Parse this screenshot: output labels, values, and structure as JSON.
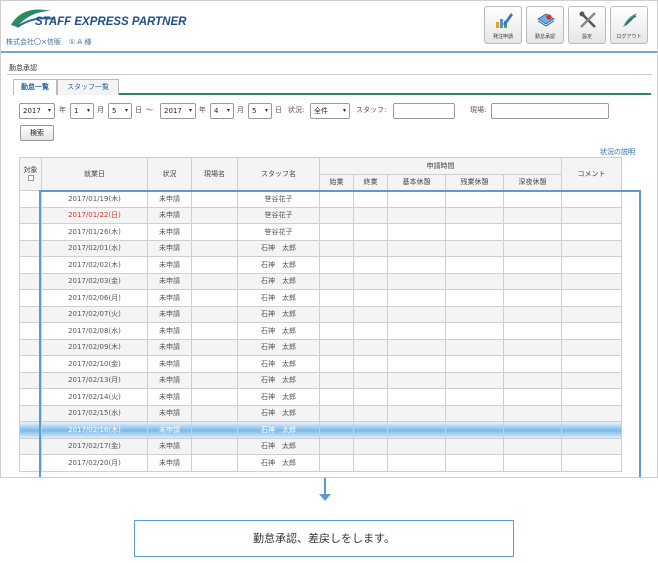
{
  "header": {
    "logo_text": "STAFF EXPRESS PARTNER",
    "company": "株式会社〇×信販",
    "user_marker": "①",
    "user_name": "A 様",
    "buttons": [
      {
        "label": "発注申請",
        "icon": "pen-chart-icon"
      },
      {
        "label": "勤怠承認",
        "icon": "approve-stamp-icon"
      },
      {
        "label": "設定",
        "icon": "tools-icon"
      },
      {
        "label": "ログアウト",
        "icon": "logout-icon"
      }
    ]
  },
  "page": {
    "title": "勤怠承認",
    "tabs": [
      {
        "label": "勤怠一覧",
        "active": true
      },
      {
        "label": "スタッフ一覧",
        "active": false
      }
    ]
  },
  "filter": {
    "from_year": "2017",
    "from_month": "1",
    "from_day": "5",
    "to_year": "2017",
    "to_month": "4",
    "to_day": "5",
    "year_label": "年",
    "month_label": "月",
    "day_label": "日",
    "range_sep": "～",
    "status_label": "状況:",
    "status_value": "全件",
    "staff_label": "スタッフ:",
    "site_label": "現場:",
    "search_button": "検索",
    "status_help_link": "状況の説明"
  },
  "table": {
    "headers": {
      "target": "対象",
      "date": "就業日",
      "status": "状況",
      "site": "現場名",
      "staff": "スタッフ名",
      "request_time": "申請時間",
      "start": "始業",
      "end": "終業",
      "basic_break": "基本休憩",
      "overtime_break": "残業休憩",
      "night_break": "深夜休憩",
      "comment": "コメント"
    },
    "rows": [
      {
        "date": "2017/01/19(木)",
        "status": "未申請",
        "staff": "笹谷花子"
      },
      {
        "date": "2017/01/22(日)",
        "status": "未申請",
        "staff": "笹谷花子"
      },
      {
        "date": "2017/01/26(木)",
        "status": "未申請",
        "staff": "笹谷花子"
      },
      {
        "date": "2017/02/01(水)",
        "status": "未申請",
        "staff": "石神　太郎"
      },
      {
        "date": "2017/02/02(木)",
        "status": "未申請",
        "staff": "石神　太郎"
      },
      {
        "date": "2017/02/03(金)",
        "status": "未申請",
        "staff": "石神　太郎"
      },
      {
        "date": "2017/02/06(月)",
        "status": "未申請",
        "staff": "石神　太郎"
      },
      {
        "date": "2017/02/07(火)",
        "status": "未申請",
        "staff": "石神　太郎"
      },
      {
        "date": "2017/02/08(水)",
        "status": "未申請",
        "staff": "石神　太郎"
      },
      {
        "date": "2017/02/09(木)",
        "status": "未申請",
        "staff": "石神　太郎"
      },
      {
        "date": "2017/02/10(金)",
        "status": "未申請",
        "staff": "石神　太郎"
      },
      {
        "date": "2017/02/13(月)",
        "status": "未申請",
        "staff": "石神　太郎"
      },
      {
        "date": "2017/02/14(火)",
        "status": "未申請",
        "staff": "石神　太郎"
      },
      {
        "date": "2017/02/15(水)",
        "status": "未申請",
        "staff": "石神　太郎"
      },
      {
        "date": "2017/02/16(木)",
        "status": "未申請",
        "staff": "石神　太郎"
      },
      {
        "date": "2017/02/17(金)",
        "status": "未申請",
        "staff": "石神　太郎"
      },
      {
        "date": "2017/02/20(月)",
        "status": "未申請",
        "staff": "石神　太郎"
      }
    ]
  },
  "caption": "勤怠承認、差戻しをします。",
  "colors": {
    "accent_green": "#2a8c5e",
    "link_blue": "#2a68a6",
    "highlight_blue": "#5a9bd4",
    "holiday_red": "#d0342c"
  }
}
